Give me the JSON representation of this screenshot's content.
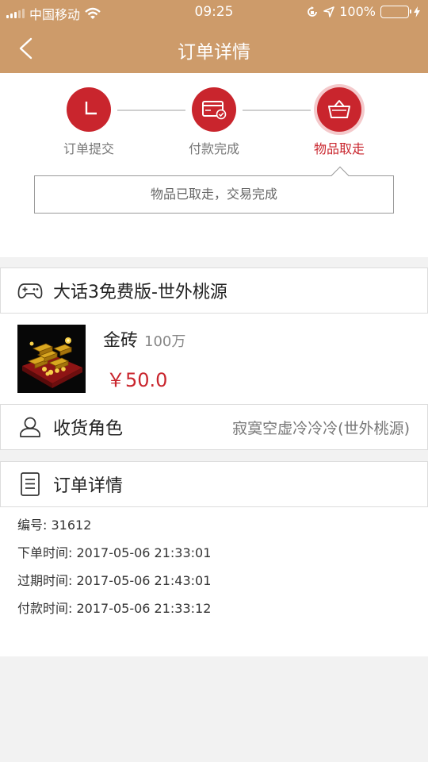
{
  "status_bar": {
    "carrier": "中国移动",
    "time": "09:25",
    "battery": "100%",
    "icons": [
      "signal-icon",
      "wifi-icon",
      "orientation-lock-icon",
      "location-icon",
      "battery-icon",
      "charging-icon"
    ]
  },
  "nav": {
    "title": "订单详情",
    "back_icon": "chevron-left-icon"
  },
  "steps": {
    "items": [
      {
        "label": "订单提交",
        "icon": "clock-icon"
      },
      {
        "label": "付款完成",
        "icon": "card-check-icon"
      },
      {
        "label": "物品取走",
        "icon": "basket-icon"
      }
    ],
    "active_index": 2,
    "status_message": "物品已取走，交易完成"
  },
  "game": {
    "icon": "gamepad-icon",
    "name": "大话3免费版-世外桃源"
  },
  "product": {
    "image_icon": "gold-bars-image",
    "name": "金砖",
    "quantity": "100万",
    "price": "￥50.0"
  },
  "receiver": {
    "icon": "user-icon",
    "label": "收货角色",
    "value": "寂寞空虚冷冷冷(世外桃源)"
  },
  "order": {
    "icon": "document-icon",
    "header": "订单详情",
    "lines": [
      "编号: 31612",
      "下单时间: 2017-05-06 21:33:01",
      "过期时间: 2017-05-06 21:43:01",
      "付款时间: 2017-05-06 21:33:12"
    ]
  },
  "colors": {
    "header_bg": "#cd9b6a",
    "accent_red": "#c9252d",
    "battery_green": "#4cd964",
    "page_bg": "#f2f2f2"
  }
}
